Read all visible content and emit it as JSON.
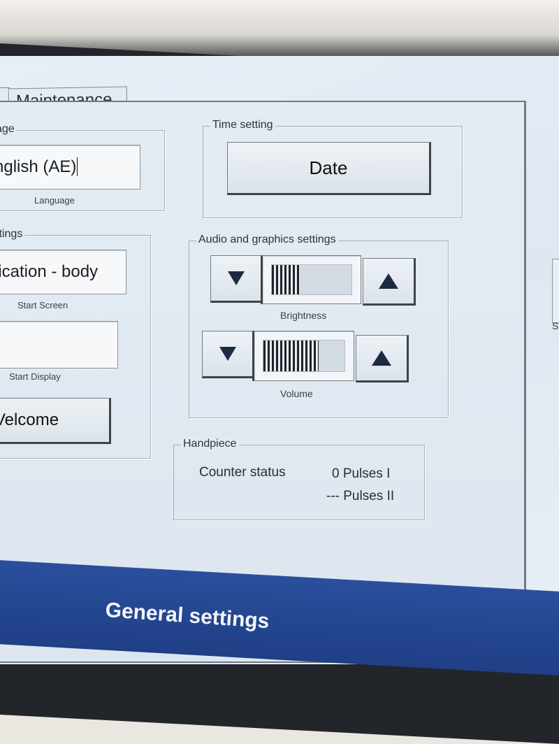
{
  "tabs": [
    {
      "label": ""
    },
    {
      "label": "Maintenance"
    }
  ],
  "language_group": {
    "title": "age",
    "value": "nglish (AE)",
    "caption": "Language"
  },
  "start_settings": {
    "title": "ttings",
    "start_screen_value": "lication - body",
    "start_screen_caption": "Start Screen",
    "start_display_value": "",
    "start_display_caption": "Start Display",
    "welcome_label": "Velcome"
  },
  "time_setting": {
    "title": "Time setting",
    "date_label": "Date"
  },
  "audio_graphics": {
    "title": "Audio and graphics settings",
    "brightness": {
      "label": "Brightness",
      "level": 0.35
    },
    "volume": {
      "label": "Volume",
      "level": 0.68
    }
  },
  "handpiece": {
    "title": "Handpiece",
    "counter_label": "Counter status",
    "pulses_1": "0 Pulses I",
    "pulses_2": "--- Pulses II"
  },
  "side_panel": {
    "caption": "S"
  },
  "footer": {
    "title": "General settings"
  },
  "colors": {
    "footer_bar": "#2a4f9c",
    "screen_bg": "#e2eaf2",
    "arrow": "#1d2a44"
  }
}
